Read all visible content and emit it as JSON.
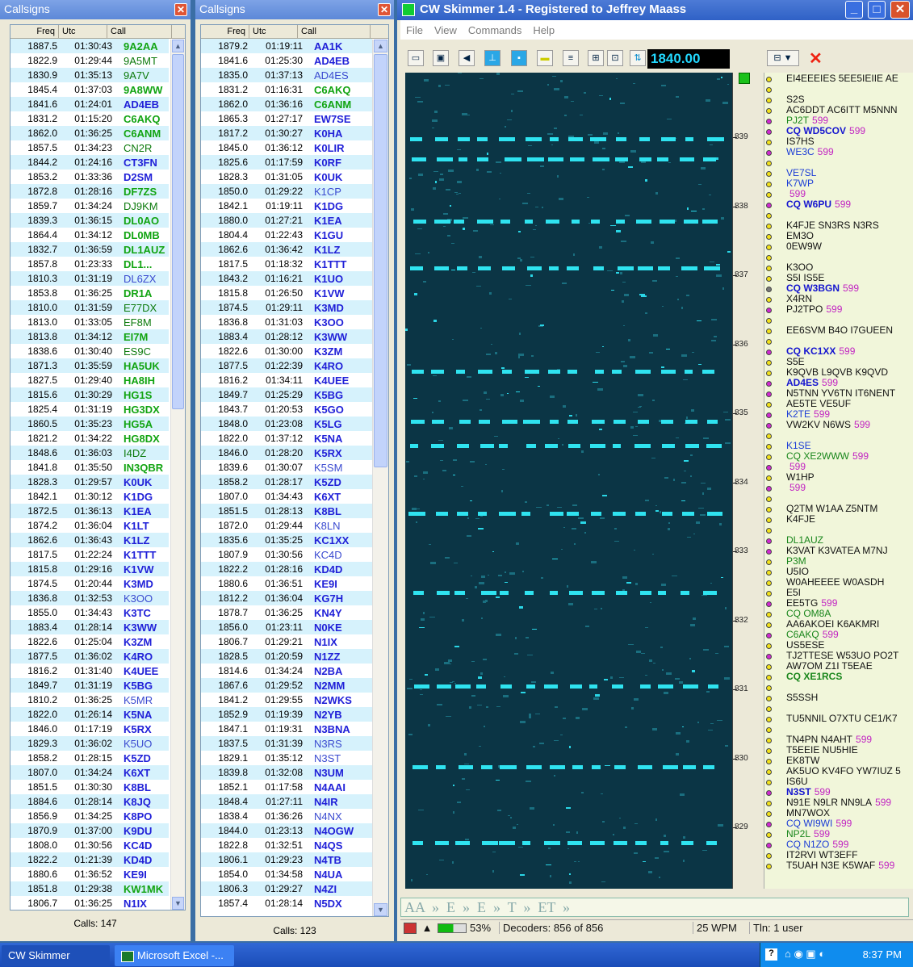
{
  "left_pane": {
    "title": "Callsigns",
    "headers": {
      "freq": "Freq",
      "utc": "Utc",
      "call": "Call"
    },
    "status": "Calls: 147",
    "rows": [
      [
        "1887.5",
        "01:30:43",
        "9A2AA",
        "st"
      ],
      [
        "1822.9",
        "01:29:44",
        "9A5MT",
        "wk"
      ],
      [
        "1830.9",
        "01:35:13",
        "9A7V",
        "wk"
      ],
      [
        "1845.4",
        "01:37:03",
        "9A8WW",
        "st"
      ],
      [
        "1841.6",
        "01:24:01",
        "AD4EB",
        "bl"
      ],
      [
        "1831.2",
        "01:15:20",
        "C6AKQ",
        "st"
      ],
      [
        "1862.0",
        "01:36:25",
        "C6ANM",
        "st"
      ],
      [
        "1857.5",
        "01:34:23",
        "CN2R",
        "wk"
      ],
      [
        "1844.2",
        "01:24:16",
        "CT3FN",
        "bl"
      ],
      [
        "1853.2",
        "01:33:36",
        "D2SM",
        "bl"
      ],
      [
        "1872.8",
        "01:28:16",
        "DF7ZS",
        "st"
      ],
      [
        "1859.7",
        "01:34:24",
        "DJ9KM",
        "wk"
      ],
      [
        "1839.3",
        "01:36:15",
        "DL0AO",
        "st"
      ],
      [
        "1864.4",
        "01:34:12",
        "DL0MB",
        "st"
      ],
      [
        "1832.7",
        "01:36:59",
        "DL1AUZ",
        "st"
      ],
      [
        "1857.8",
        "01:23:33",
        "DL1...",
        "st"
      ],
      [
        "1810.3",
        "01:31:19",
        "DL6ZX",
        "lb"
      ],
      [
        "1853.8",
        "01:36:25",
        "DR1A",
        "st"
      ],
      [
        "1810.0",
        "01:31:59",
        "E77DX",
        "wk"
      ],
      [
        "1813.0",
        "01:33:05",
        "EF8M",
        "wk"
      ],
      [
        "1813.8",
        "01:34:12",
        "EI7M",
        "st"
      ],
      [
        "1838.6",
        "01:30:40",
        "ES9C",
        "wk"
      ],
      [
        "1871.3",
        "01:35:59",
        "HA5UK",
        "st"
      ],
      [
        "1827.5",
        "01:29:40",
        "HA8IH",
        "st"
      ],
      [
        "1815.6",
        "01:30:29",
        "HG1S",
        "st"
      ],
      [
        "1825.4",
        "01:31:19",
        "HG3DX",
        "st"
      ],
      [
        "1860.5",
        "01:35:23",
        "HG5A",
        "st"
      ],
      [
        "1821.2",
        "01:34:22",
        "HG8DX",
        "st"
      ],
      [
        "1848.6",
        "01:36:03",
        "I4DZ",
        "wk"
      ],
      [
        "1841.8",
        "01:35:50",
        "IN3QBR",
        "st"
      ],
      [
        "1828.3",
        "01:29:57",
        "K0UK",
        "bl"
      ],
      [
        "1842.1",
        "01:30:12",
        "K1DG",
        "bl"
      ],
      [
        "1872.5",
        "01:36:13",
        "K1EA",
        "bl"
      ],
      [
        "1874.2",
        "01:36:04",
        "K1LT",
        "bl"
      ],
      [
        "1862.6",
        "01:36:43",
        "K1LZ",
        "bl"
      ],
      [
        "1817.5",
        "01:22:24",
        "K1TTT",
        "bl"
      ],
      [
        "1815.8",
        "01:29:16",
        "K1VW",
        "bl"
      ],
      [
        "1874.5",
        "01:20:44",
        "K3MD",
        "bl"
      ],
      [
        "1836.8",
        "01:32:53",
        "K3OO",
        "lb"
      ],
      [
        "1855.0",
        "01:34:43",
        "K3TC",
        "bl"
      ],
      [
        "1883.4",
        "01:28:14",
        "K3WW",
        "bl"
      ],
      [
        "1822.6",
        "01:25:04",
        "K3ZM",
        "bl"
      ],
      [
        "1877.5",
        "01:36:02",
        "K4RO",
        "bl"
      ],
      [
        "1816.2",
        "01:31:40",
        "K4UEE",
        "bl"
      ],
      [
        "1849.7",
        "01:31:19",
        "K5BG",
        "bl"
      ],
      [
        "1810.2",
        "01:36:25",
        "K5MR",
        "lb"
      ],
      [
        "1822.0",
        "01:26:14",
        "K5NA",
        "bl"
      ],
      [
        "1846.0",
        "01:17:19",
        "K5RX",
        "bl"
      ],
      [
        "1829.3",
        "01:36:02",
        "K5UO",
        "lb"
      ],
      [
        "1858.2",
        "01:28:15",
        "K5ZD",
        "bl"
      ],
      [
        "1807.0",
        "01:34:24",
        "K6XT",
        "bl"
      ],
      [
        "1851.5",
        "01:30:30",
        "K8BL",
        "bl"
      ],
      [
        "1884.6",
        "01:28:14",
        "K8JQ",
        "bl"
      ],
      [
        "1856.9",
        "01:34:25",
        "K8PO",
        "bl"
      ],
      [
        "1870.9",
        "01:37:00",
        "K9DU",
        "bl"
      ],
      [
        "1808.0",
        "01:30:56",
        "KC4D",
        "bl"
      ],
      [
        "1822.2",
        "01:21:39",
        "KD4D",
        "bl"
      ],
      [
        "1880.6",
        "01:36:52",
        "KE9I",
        "bl"
      ],
      [
        "1851.8",
        "01:29:38",
        "KW1MK",
        "st"
      ],
      [
        "1806.7",
        "01:36:25",
        "N1IX",
        "bl"
      ]
    ]
  },
  "mid_pane": {
    "title": "Callsigns",
    "headers": {
      "freq": "Freq",
      "utc": "Utc",
      "call": "Call"
    },
    "status": "Calls: 123",
    "rows": [
      [
        "1879.2",
        "01:19:11",
        "AA1K",
        "bl"
      ],
      [
        "1841.6",
        "01:25:30",
        "AD4EB",
        "bl"
      ],
      [
        "1835.0",
        "01:37:13",
        "AD4ES",
        "lb"
      ],
      [
        "1831.2",
        "01:16:31",
        "C6AKQ",
        "st"
      ],
      [
        "1862.0",
        "01:36:16",
        "C6ANM",
        "st"
      ],
      [
        "1865.3",
        "01:27:17",
        "EW7SE",
        "bl"
      ],
      [
        "1817.2",
        "01:30:27",
        "K0HA",
        "bl"
      ],
      [
        "1845.0",
        "01:36:12",
        "K0LIR",
        "bl"
      ],
      [
        "1825.6",
        "01:17:59",
        "K0RF",
        "bl"
      ],
      [
        "1828.3",
        "01:31:05",
        "K0UK",
        "bl"
      ],
      [
        "1850.0",
        "01:29:22",
        "K1CP",
        "lb"
      ],
      [
        "1842.1",
        "01:19:11",
        "K1DG",
        "bl"
      ],
      [
        "1880.0",
        "01:27:21",
        "K1EA",
        "bl"
      ],
      [
        "1804.4",
        "01:22:43",
        "K1GU",
        "bl"
      ],
      [
        "1862.6",
        "01:36:42",
        "K1LZ",
        "bl"
      ],
      [
        "1817.5",
        "01:18:32",
        "K1TTT",
        "bl"
      ],
      [
        "1843.2",
        "01:16:21",
        "K1UO",
        "bl"
      ],
      [
        "1815.8",
        "01:26:50",
        "K1VW",
        "bl"
      ],
      [
        "1874.5",
        "01:29:11",
        "K3MD",
        "bl"
      ],
      [
        "1836.8",
        "01:31:03",
        "K3OO",
        "bl"
      ],
      [
        "1883.4",
        "01:28:12",
        "K3WW",
        "bl"
      ],
      [
        "1822.6",
        "01:30:00",
        "K3ZM",
        "bl"
      ],
      [
        "1877.5",
        "01:22:39",
        "K4RO",
        "bl"
      ],
      [
        "1816.2",
        "01:34:11",
        "K4UEE",
        "bl"
      ],
      [
        "1849.7",
        "01:25:29",
        "K5BG",
        "bl"
      ],
      [
        "1843.7",
        "01:20:53",
        "K5GO",
        "bl"
      ],
      [
        "1848.0",
        "01:23:08",
        "K5LG",
        "bl"
      ],
      [
        "1822.0",
        "01:37:12",
        "K5NA",
        "bl"
      ],
      [
        "1846.0",
        "01:28:20",
        "K5RX",
        "bl"
      ],
      [
        "1839.6",
        "01:30:07",
        "K5SM",
        "lb"
      ],
      [
        "1858.2",
        "01:28:17",
        "K5ZD",
        "bl"
      ],
      [
        "1807.0",
        "01:34:43",
        "K6XT",
        "bl"
      ],
      [
        "1851.5",
        "01:28:13",
        "K8BL",
        "bl"
      ],
      [
        "1872.0",
        "01:29:44",
        "K8LN",
        "lb"
      ],
      [
        "1835.6",
        "01:35:25",
        "KC1XX",
        "bl"
      ],
      [
        "1807.9",
        "01:30:56",
        "KC4D",
        "lb"
      ],
      [
        "1822.2",
        "01:28:16",
        "KD4D",
        "bl"
      ],
      [
        "1880.6",
        "01:36:51",
        "KE9I",
        "bl"
      ],
      [
        "1812.2",
        "01:36:04",
        "KG7H",
        "bl"
      ],
      [
        "1878.7",
        "01:36:25",
        "KN4Y",
        "bl"
      ],
      [
        "1856.0",
        "01:23:11",
        "N0KE",
        "bl"
      ],
      [
        "1806.7",
        "01:29:21",
        "N1IX",
        "bl"
      ],
      [
        "1828.5",
        "01:20:59",
        "N1ZZ",
        "bl"
      ],
      [
        "1814.6",
        "01:34:24",
        "N2BA",
        "bl"
      ],
      [
        "1867.6",
        "01:29:52",
        "N2MM",
        "bl"
      ],
      [
        "1841.2",
        "01:29:55",
        "N2WKS",
        "bl"
      ],
      [
        "1852.9",
        "01:19:39",
        "N2YB",
        "bl"
      ],
      [
        "1847.1",
        "01:19:31",
        "N3BNA",
        "bl"
      ],
      [
        "1837.5",
        "01:31:39",
        "N3RS",
        "lb"
      ],
      [
        "1829.1",
        "01:35:12",
        "N3ST",
        "lb"
      ],
      [
        "1839.8",
        "01:32:08",
        "N3UM",
        "bl"
      ],
      [
        "1852.1",
        "01:17:58",
        "N4AAI",
        "bl"
      ],
      [
        "1848.4",
        "01:27:11",
        "N4IR",
        "bl"
      ],
      [
        "1838.4",
        "01:36:26",
        "N4NX",
        "lb"
      ],
      [
        "1844.0",
        "01:23:13",
        "N4OGW",
        "bl"
      ],
      [
        "1822.8",
        "01:32:51",
        "N4QS",
        "bl"
      ],
      [
        "1806.1",
        "01:29:23",
        "N4TB",
        "bl"
      ],
      [
        "1854.0",
        "01:34:58",
        "N4UA",
        "bl"
      ],
      [
        "1806.3",
        "01:29:27",
        "N4ZI",
        "bl"
      ],
      [
        "1857.4",
        "01:28:14",
        "N5DX",
        "bl"
      ]
    ]
  },
  "skimmer": {
    "title": "CW Skimmer 1.4 - Registered to Jeffrey Maass",
    "menu": [
      "File",
      "View",
      "Commands",
      "Help"
    ],
    "frequency": "1840.00",
    "ruler_labels": [
      "839",
      "838",
      "837",
      "836",
      "835",
      "834",
      "833",
      "832",
      "831",
      "830",
      "829"
    ],
    "decoded": [
      {
        "t": "EI4EEEIES 5EE5IEIIE AE",
        "k": "n",
        "d": "y",
        "sfx": ""
      },
      {
        "t": "",
        "k": "n",
        "d": "y",
        "sfx": ""
      },
      {
        "t": "S2S",
        "k": "n",
        "d": "y",
        "sfx": ""
      },
      {
        "t": "AC6DDT AC6ITT M5NNN",
        "k": "n",
        "d": "y",
        "sfx": ""
      },
      {
        "t": "PJ2T",
        "k": "g",
        "d": "m",
        "sfx": "599"
      },
      {
        "t": "CQ WD5COV",
        "k": "cq",
        "d": "m",
        "sfx": "599"
      },
      {
        "t": "IS7HS",
        "k": "n",
        "d": "y",
        "sfx": ""
      },
      {
        "t": "WE3C",
        "k": "b",
        "d": "m",
        "sfx": "599"
      },
      {
        "t": "",
        "k": "n",
        "d": "y",
        "sfx": ""
      },
      {
        "t": "VE7SL",
        "k": "b",
        "d": "y",
        "sfx": ""
      },
      {
        "t": "K7WP",
        "k": "b",
        "d": "y",
        "sfx": ""
      },
      {
        "t": "",
        "k": "n",
        "d": "y",
        "sfx": "599"
      },
      {
        "t": "CQ W6PU",
        "k": "cq",
        "d": "m",
        "sfx": "599"
      },
      {
        "t": "",
        "k": "n",
        "d": "y",
        "sfx": ""
      },
      {
        "t": "K4FJE SN3RS N3RS",
        "k": "n",
        "d": "y",
        "sfx": ""
      },
      {
        "t": "EM3O",
        "k": "n",
        "d": "y",
        "sfx": ""
      },
      {
        "t": "0EW9W",
        "k": "n",
        "d": "y",
        "sfx": ""
      },
      {
        "t": "",
        "k": "n",
        "d": "y",
        "sfx": ""
      },
      {
        "t": "K3OO",
        "k": "n",
        "d": "y",
        "sfx": ""
      },
      {
        "t": "S5I IS5E",
        "k": "n",
        "d": "y",
        "sfx": ""
      },
      {
        "t": "CQ W3BGN",
        "k": "cq",
        "d": "gr",
        "sfx": "599"
      },
      {
        "t": "X4RN",
        "k": "n",
        "d": "y",
        "sfx": ""
      },
      {
        "t": "PJ2TPO",
        "k": "n",
        "d": "m",
        "sfx": "599"
      },
      {
        "t": "",
        "k": "n",
        "d": "y",
        "sfx": ""
      },
      {
        "t": "EE6SVM B4O I7GUEEN",
        "k": "n",
        "d": "y",
        "sfx": ""
      },
      {
        "t": "",
        "k": "n",
        "d": "y",
        "sfx": ""
      },
      {
        "t": "CQ KC1XX",
        "k": "cq",
        "d": "m",
        "sfx": "599"
      },
      {
        "t": "S5E",
        "k": "n",
        "d": "y",
        "sfx": ""
      },
      {
        "t": "K9QVB L9QVB K9QVD",
        "k": "n",
        "d": "y",
        "sfx": ""
      },
      {
        "t": "AD4ES",
        "k": "cq",
        "d": "m",
        "sfx": "599"
      },
      {
        "t": "N5TNN YV6TN IT6NENT",
        "k": "n",
        "d": "m",
        "sfx": ""
      },
      {
        "t": "AE5TE VE5UF",
        "k": "n",
        "d": "y",
        "sfx": ""
      },
      {
        "t": "K2TE",
        "k": "b",
        "d": "m",
        "sfx": "599"
      },
      {
        "t": "VW2KV N6WS",
        "k": "n",
        "d": "m",
        "sfx": "599"
      },
      {
        "t": "",
        "k": "n",
        "d": "y",
        "sfx": ""
      },
      {
        "t": "K1SE",
        "k": "b",
        "d": "y",
        "sfx": ""
      },
      {
        "t": "CQ XE2WWW",
        "k": "g",
        "d": "y",
        "sfx": "599"
      },
      {
        "t": "",
        "k": "n",
        "d": "m",
        "sfx": "599"
      },
      {
        "t": "W1HP",
        "k": "n",
        "d": "y",
        "sfx": ""
      },
      {
        "t": "",
        "k": "n",
        "d": "m",
        "sfx": "599"
      },
      {
        "t": "",
        "k": "n",
        "d": "y",
        "sfx": ""
      },
      {
        "t": "Q2TM W1AA Z5NTM",
        "k": "n",
        "d": "y",
        "sfx": ""
      },
      {
        "t": "K4FJE",
        "k": "n",
        "d": "y",
        "sfx": ""
      },
      {
        "t": "",
        "k": "n",
        "d": "y",
        "sfx": ""
      },
      {
        "t": "DL1AUZ",
        "k": "g",
        "d": "m",
        "sfx": ""
      },
      {
        "t": "K3VAT K3VATEA M7NJ",
        "k": "n",
        "d": "m",
        "sfx": ""
      },
      {
        "t": "P3M",
        "k": "g",
        "d": "y",
        "sfx": ""
      },
      {
        "t": "U5IO",
        "k": "n",
        "d": "y",
        "sfx": ""
      },
      {
        "t": "W0AHEEEE W0ASDH",
        "k": "n",
        "d": "y",
        "sfx": ""
      },
      {
        "t": "E5I",
        "k": "n",
        "d": "y",
        "sfx": ""
      },
      {
        "t": "EE5TG",
        "k": "n",
        "d": "m",
        "sfx": "599"
      },
      {
        "t": "CQ OM8A",
        "k": "g",
        "d": "y",
        "sfx": ""
      },
      {
        "t": "AA6AKOEI K6AKMRI",
        "k": "n",
        "d": "y",
        "sfx": ""
      },
      {
        "t": "C6AKQ",
        "k": "g",
        "d": "m",
        "sfx": "599"
      },
      {
        "t": "US5ESE",
        "k": "n",
        "d": "y",
        "sfx": ""
      },
      {
        "t": "TJ2TTESE W53UO PO2T",
        "k": "n",
        "d": "m",
        "sfx": ""
      },
      {
        "t": "AW7OM Z1I T5EAE",
        "k": "n",
        "d": "y",
        "sfx": ""
      },
      {
        "t": "CQ XE1RCS",
        "k": "gb",
        "d": "y",
        "sfx": ""
      },
      {
        "t": "",
        "k": "n",
        "d": "y",
        "sfx": ""
      },
      {
        "t": "S5SSH",
        "k": "n",
        "d": "y",
        "sfx": ""
      },
      {
        "t": "",
        "k": "n",
        "d": "y",
        "sfx": ""
      },
      {
        "t": "TU5NNIL O7XTU CE1/K7",
        "k": "n",
        "d": "y",
        "sfx": ""
      },
      {
        "t": "",
        "k": "n",
        "d": "y",
        "sfx": ""
      },
      {
        "t": "TN4PN N4AHT",
        "k": "n",
        "d": "y",
        "sfx": "599"
      },
      {
        "t": "T5EEIE NU5HIE",
        "k": "n",
        "d": "y",
        "sfx": ""
      },
      {
        "t": "EK8TW",
        "k": "n",
        "d": "y",
        "sfx": ""
      },
      {
        "t": "AK5UO KV4FO YW7IUZ 5",
        "k": "n",
        "d": "y",
        "sfx": ""
      },
      {
        "t": "IS6U",
        "k": "n",
        "d": "y",
        "sfx": ""
      },
      {
        "t": "N3ST",
        "k": "cq",
        "d": "m",
        "sfx": "599"
      },
      {
        "t": "N91E N9LR NN9LA",
        "k": "n",
        "d": "y",
        "sfx": "599"
      },
      {
        "t": "MN7WOX",
        "k": "n",
        "d": "y",
        "sfx": ""
      },
      {
        "t": "CQ WI9WI",
        "k": "b",
        "d": "m",
        "sfx": "599"
      },
      {
        "t": "NP2L",
        "k": "g",
        "d": "y",
        "sfx": "599"
      },
      {
        "t": "CQ N1ZO",
        "k": "b",
        "d": "m",
        "sfx": "599"
      },
      {
        "t": "IT2RVI WT3EFF",
        "k": "n",
        "d": "y",
        "sfx": ""
      },
      {
        "t": "T5UAH N3E K5WAF",
        "k": "n",
        "d": "y",
        "sfx": "599"
      }
    ],
    "decode_bar": "AA  »  E  »  E  »  T  »  ET  »",
    "status": {
      "cpu": "53%",
      "decoders": "Decoders: 856 of 856",
      "wpm": "25 WPM",
      "telnet": "Tln: 1 user"
    }
  },
  "taskbar": {
    "buttons": [
      "CW Skimmer",
      "Microsoft Excel -..."
    ],
    "clock": "8:37 PM"
  }
}
